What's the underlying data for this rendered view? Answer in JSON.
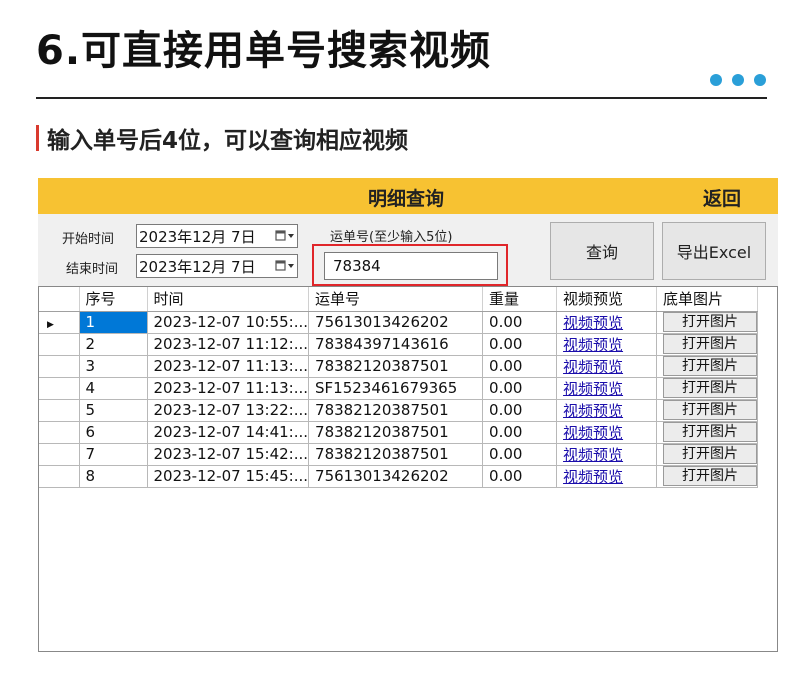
{
  "page": {
    "title": "6.可直接用单号搜索视频",
    "subtitle": "输入单号后4位，可以查询相应视频",
    "accent_color": "#2a9fd8",
    "subtitle_bar_color": "#d93a2e"
  },
  "app": {
    "header_color": "#f7c232",
    "title": "明细查询",
    "back_label": "返回",
    "start_label": "开始时间",
    "end_label": "结束时间",
    "start_date": "2023年12月  7日",
    "end_date": "2023年12月  7日",
    "waybill_label": "运单号(至少输入5位)",
    "waybill_value": "78384",
    "query_label": "查询",
    "export_label": "导出Excel",
    "highlight_color": "#e0262a"
  },
  "grid": {
    "columns": [
      "序号",
      "时间",
      "运单号",
      "重量",
      "视频预览",
      "底单图片"
    ],
    "rows": [
      {
        "no": "1",
        "time": "2023-12-07 10:55:...",
        "waybill": "75613013426202",
        "weight": "0.00",
        "preview": "视频预览",
        "image": "打开图片"
      },
      {
        "no": "2",
        "time": "2023-12-07 11:12:...",
        "waybill": "78384397143616",
        "weight": "0.00",
        "preview": "视频预览",
        "image": "打开图片"
      },
      {
        "no": "3",
        "time": "2023-12-07 11:13:...",
        "waybill": "78382120387501",
        "weight": "0.00",
        "preview": "视频预览",
        "image": "打开图片"
      },
      {
        "no": "4",
        "time": "2023-12-07 11:13:...",
        "waybill": "SF1523461679365",
        "weight": "0.00",
        "preview": "视频预览",
        "image": "打开图片"
      },
      {
        "no": "5",
        "time": "2023-12-07 13:22:...",
        "waybill": "78382120387501",
        "weight": "0.00",
        "preview": "视频预览",
        "image": "打开图片"
      },
      {
        "no": "6",
        "time": "2023-12-07 14:41:...",
        "waybill": "78382120387501",
        "weight": "0.00",
        "preview": "视频预览",
        "image": "打开图片"
      },
      {
        "no": "7",
        "time": "2023-12-07 15:42:...",
        "waybill": "78382120387501",
        "weight": "0.00",
        "preview": "视频预览",
        "image": "打开图片"
      },
      {
        "no": "8",
        "time": "2023-12-07 15:45:...",
        "waybill": "75613013426202",
        "weight": "0.00",
        "preview": "视频预览",
        "image": "打开图片"
      }
    ]
  }
}
